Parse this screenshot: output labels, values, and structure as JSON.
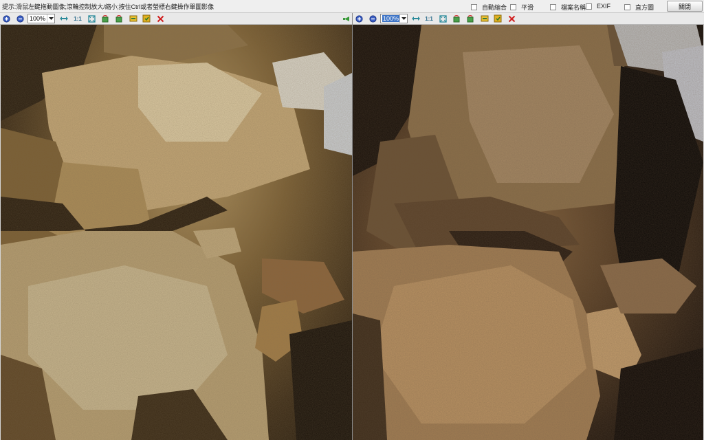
{
  "header": {
    "hint": "提示:滑鼠左鍵拖動圖像;滾輪控制放大/縮小;按住Ctrl或者螢標右鍵操作單圖影像",
    "options": [
      {
        "label": "自動縮合",
        "checked": false
      },
      {
        "label": "平滑",
        "checked": false
      },
      {
        "label": "檔案名稱",
        "checked": false
      },
      {
        "label": "EXIF",
        "checked": false
      },
      {
        "label": "直方圖",
        "checked": false
      }
    ],
    "close_label": "關閉"
  },
  "left_toolbar": {
    "zoom_value": "100%",
    "one_to_one": "1:1",
    "icons": [
      "zoom-in-icon",
      "zoom-out-icon",
      "fit-width-icon",
      "fit-screen-icon",
      "rotate-left-icon",
      "rotate-right-icon",
      "flip-icon",
      "save-icon",
      "delete-icon",
      "sync-arrow-icon"
    ]
  },
  "right_toolbar": {
    "zoom_value": "100%",
    "one_to_one": "1:1",
    "icons": [
      "zoom-in-icon",
      "zoom-out-icon",
      "fit-width-icon",
      "fit-screen-icon",
      "rotate-left-icon",
      "rotate-right-icon",
      "flip-icon",
      "save-icon",
      "delete-icon"
    ]
  },
  "colors": {
    "header_bg": "#efefef",
    "toolbar_bg": "#e9e9e9",
    "selection_blue": "#3d74c6",
    "delete_red": "#d02020",
    "rock_light": "#d8c9a6",
    "rock_shadow": "#1c140a"
  }
}
